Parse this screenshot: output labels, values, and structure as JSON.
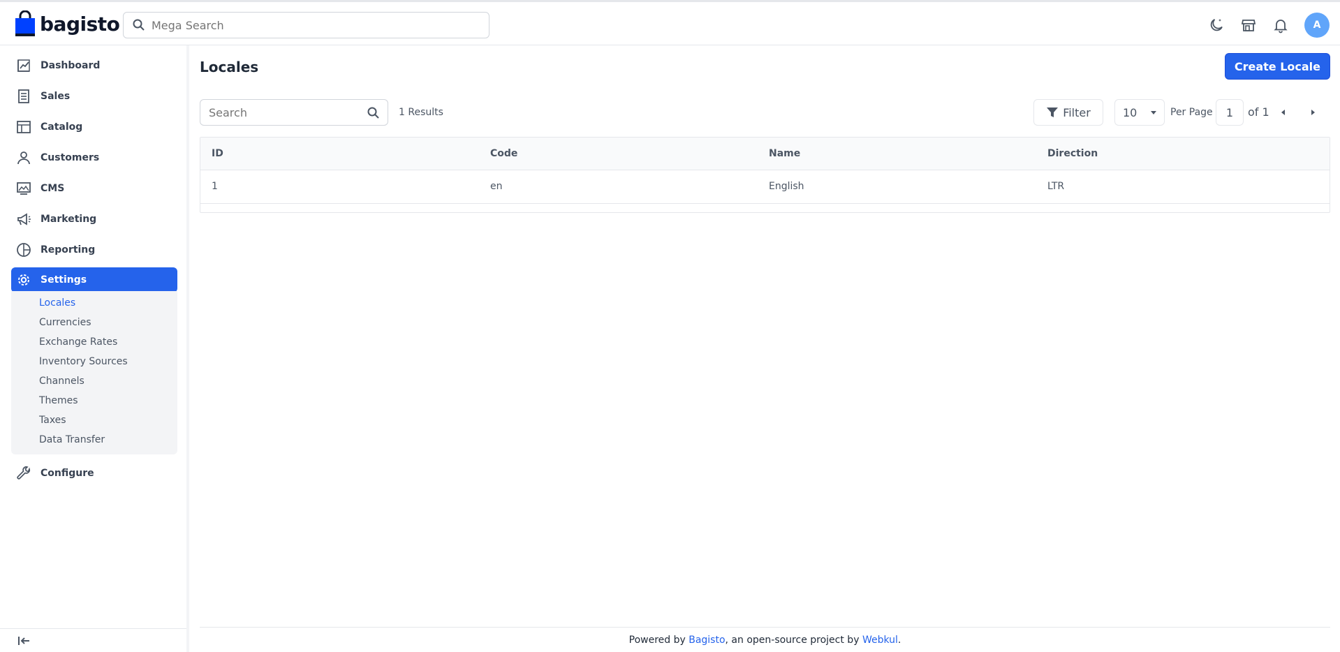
{
  "app": {
    "logo_text": "bagisto"
  },
  "header": {
    "search_placeholder": "Mega Search",
    "avatar_initial": "A"
  },
  "sidebar": {
    "items": [
      {
        "label": "Dashboard",
        "icon": "dashboard-icon"
      },
      {
        "label": "Sales",
        "icon": "sales-icon"
      },
      {
        "label": "Catalog",
        "icon": "catalog-icon"
      },
      {
        "label": "Customers",
        "icon": "customers-icon"
      },
      {
        "label": "CMS",
        "icon": "cms-icon"
      },
      {
        "label": "Marketing",
        "icon": "marketing-icon"
      },
      {
        "label": "Reporting",
        "icon": "reporting-icon"
      },
      {
        "label": "Settings",
        "icon": "settings-icon",
        "active": true
      },
      {
        "label": "Configure",
        "icon": "configure-icon"
      }
    ],
    "settings_submenu": [
      {
        "label": "Locales",
        "active": true
      },
      {
        "label": "Currencies"
      },
      {
        "label": "Exchange Rates"
      },
      {
        "label": "Inventory Sources"
      },
      {
        "label": "Channels"
      },
      {
        "label": "Themes"
      },
      {
        "label": "Taxes"
      },
      {
        "label": "Data Transfer"
      }
    ]
  },
  "main": {
    "title": "Locales",
    "create_button": "Create Locale",
    "search_placeholder": "Search",
    "results_text": "1 Results",
    "filter_label": "Filter",
    "per_page_value": "10",
    "per_page_label": "Per Page",
    "page_current": "1",
    "page_of": "of 1"
  },
  "table": {
    "columns": [
      "ID",
      "Code",
      "Name",
      "Direction"
    ],
    "rows": [
      [
        "1",
        "en",
        "English",
        "LTR"
      ]
    ]
  },
  "footer": {
    "prefix": "Powered by ",
    "link1": "Bagisto",
    "middle": ", an open-source project by ",
    "link2": "Webkul",
    "suffix": "."
  },
  "colors": {
    "accent": "#2563eb",
    "logo": "#0041ff",
    "avatar": "#60a5fa"
  }
}
